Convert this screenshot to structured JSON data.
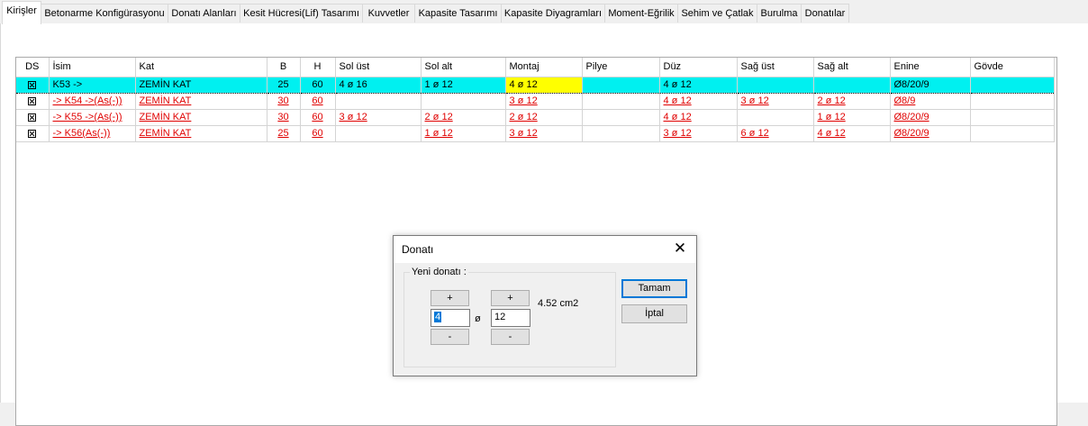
{
  "tabs": [
    {
      "label": "Kirişler",
      "active": true
    },
    {
      "label": "Betonarme Konfigürasyonu"
    },
    {
      "label": "Donatı Alanları"
    },
    {
      "label": "Kesit Hücresi(Lif) Tasarımı"
    },
    {
      "label": "Kuvvetler"
    },
    {
      "label": "Kapasite Tasarımı"
    },
    {
      "label": "Kapasite Diyagramları"
    },
    {
      "label": "Moment-Eğrilik"
    },
    {
      "label": "Sehim ve Çatlak"
    },
    {
      "label": "Burulma"
    },
    {
      "label": "Donatılar"
    }
  ],
  "table": {
    "columns": [
      "DS",
      "İsim",
      "Kat",
      "B",
      "H",
      "Sol üst",
      "Sol alt",
      "Montaj",
      "Pilye",
      "Düz",
      "Sağ üst",
      "Sağ alt",
      "Enine",
      "Gövde"
    ],
    "rows": [
      {
        "name": "K53 ->",
        "kat": "ZEMİN KAT",
        "b": "25",
        "h": "60",
        "sol_ust": "4 ø 16",
        "sol_alt": "1 ø 12",
        "montaj": "4 ø 12",
        "pilye": "",
        "duz": "4 ø 12",
        "sag_ust": "",
        "sag_alt": "",
        "enine": "Ø8/20/9",
        "govde": ""
      },
      {
        "name": "-> K54 ->(As(-))",
        "kat": "ZEMİN KAT",
        "b": "30",
        "h": "60",
        "sol_ust": "",
        "sol_alt": "",
        "montaj": "3 ø 12",
        "pilye": "",
        "duz": "4 ø 12",
        "sag_ust": "3 ø 12",
        "sag_alt": "2 ø 12",
        "enine": "Ø8/9",
        "govde": ""
      },
      {
        "name": "-> K55 ->(As(-))",
        "kat": "ZEMİN KAT",
        "b": "30",
        "h": "60",
        "sol_ust": "3 ø 12",
        "sol_alt": "2 ø 12",
        "montaj": "2 ø 12",
        "pilye": "",
        "duz": "4 ø 12",
        "sag_ust": "",
        "sag_alt": "1 ø 12",
        "enine": "Ø8/20/9",
        "govde": ""
      },
      {
        "name": "-> K56(As(-))",
        "kat": "ZEMİN KAT",
        "b": "25",
        "h": "60",
        "sol_ust": "",
        "sol_alt": "1 ø 12",
        "montaj": "3 ø 12",
        "pilye": "",
        "duz": "3 ø 12",
        "sag_ust": "6 ø 12",
        "sag_alt": "4 ø 12",
        "enine": "Ø8/20/9",
        "govde": ""
      }
    ]
  },
  "dialog": {
    "title": "Donatı",
    "close_glyph": "✕",
    "group_label": "Yeni donatı :",
    "plus_label": "+",
    "minus_label": "-",
    "count_value": "4",
    "diameter_symbol": "ø",
    "diameter_value": "12",
    "area_text": "4.52 cm2",
    "ok_label": "Tamam",
    "cancel_label": "İptal"
  },
  "colors": {
    "selected_row": "#00f0f0",
    "highlight_cell": "#ffff00",
    "link_text": "#e00000"
  }
}
